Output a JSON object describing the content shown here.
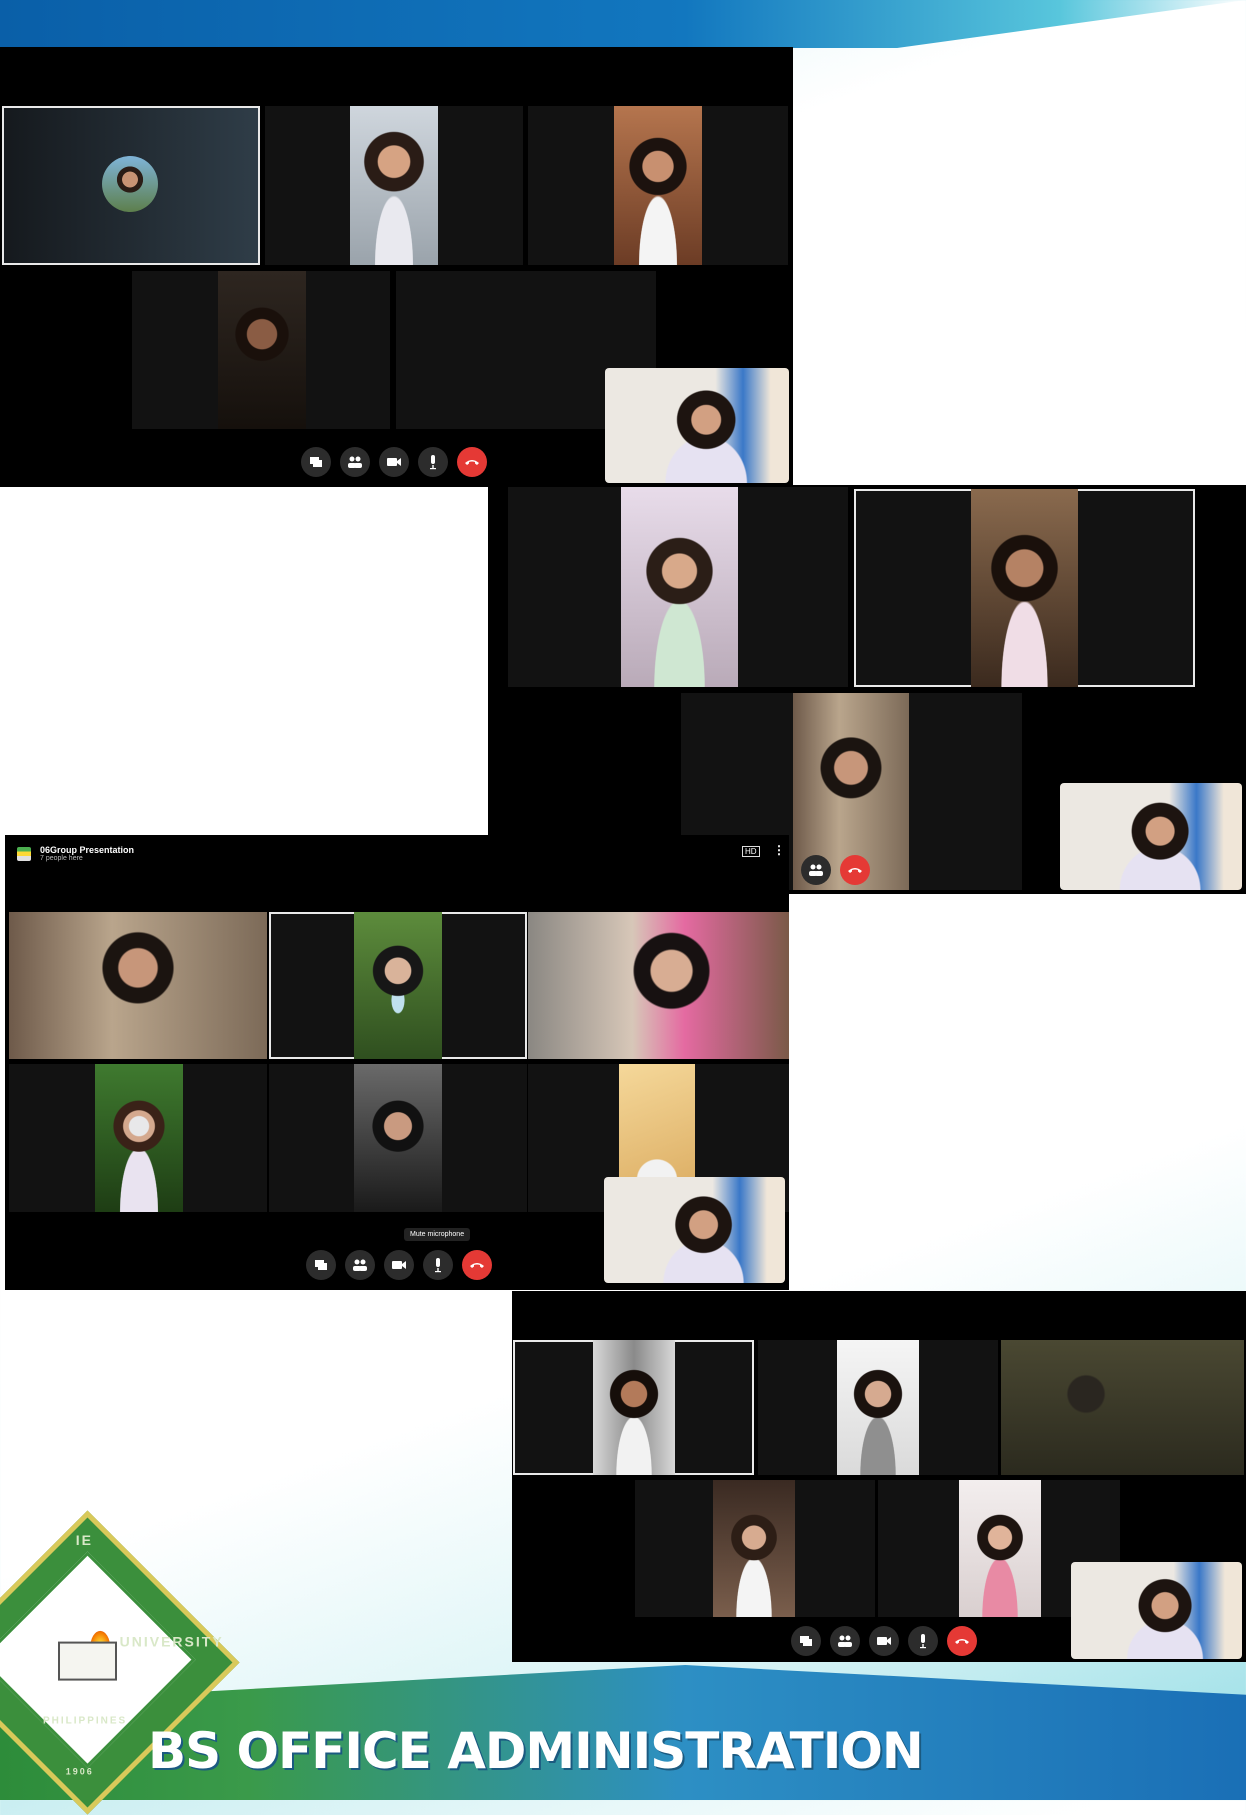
{
  "meeting": {
    "group_title": "06Group Presentation",
    "group_subtitle": "7 people here",
    "hd_badge": "HD",
    "more_glyph": "⋮",
    "tooltip": "Mute microphone"
  },
  "controls": {
    "labels": [
      "screen",
      "participants",
      "camera",
      "microphone",
      "end call"
    ]
  },
  "footer": {
    "banner": "BS OFFICE ADMINISTRATION",
    "logo_text_top": "UNIVERSITY",
    "logo_text_bottom": "PHILIPPINES",
    "logo_year": "1906",
    "logo_left": "IE"
  },
  "colors": {
    "end_call": "#e53935",
    "banner_green": "#2d8c3a",
    "banner_blue": "#1a6fb6"
  }
}
